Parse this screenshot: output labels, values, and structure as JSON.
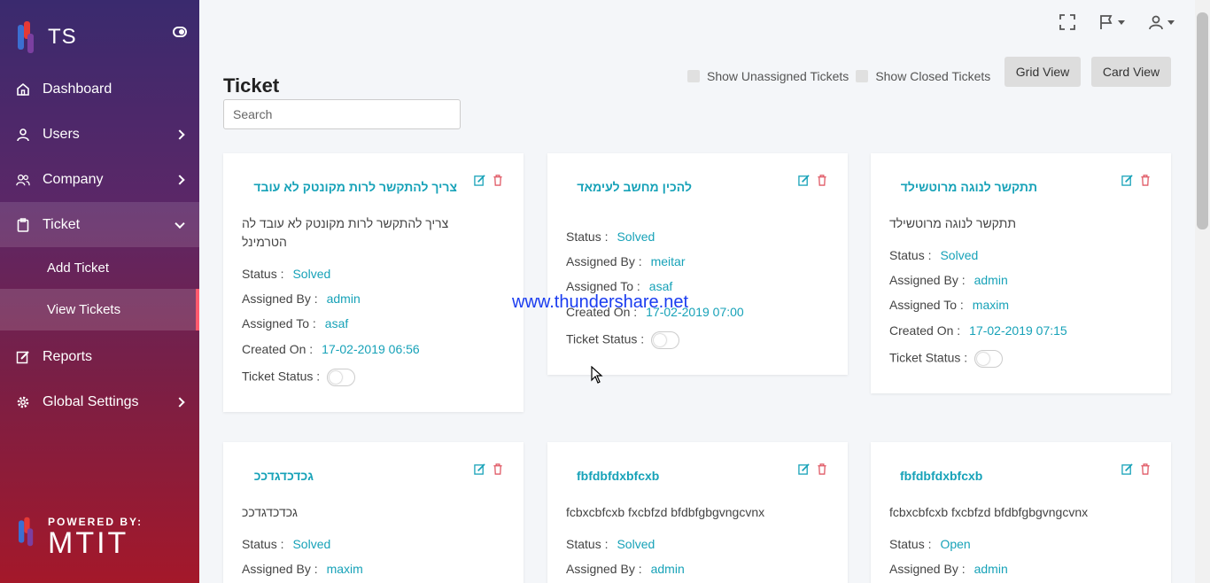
{
  "app": {
    "brand": "TS",
    "powered_by": "POWERED BY:",
    "powered_name": "MTIT"
  },
  "sidebar": {
    "items": [
      {
        "label": "Dashboard",
        "icon": "home-icon"
      },
      {
        "label": "Users",
        "icon": "user-icon"
      },
      {
        "label": "Company",
        "icon": "users-icon"
      },
      {
        "label": "Ticket",
        "icon": "clipboard-icon"
      },
      {
        "label": "Reports",
        "icon": "edit-icon"
      },
      {
        "label": "Global Settings",
        "icon": "gear-icon"
      }
    ],
    "ticket_sub": {
      "add": "Add Ticket",
      "view": "View Tickets"
    }
  },
  "header": {
    "title": "Ticket",
    "search_placeholder": "Search",
    "show_unassigned": "Show Unassigned Tickets",
    "show_closed": "Show Closed Tickets",
    "grid_view": "Grid View",
    "card_view": "Card View"
  },
  "labels": {
    "status": "Status :",
    "assigned_by": "Assigned By :",
    "assigned_to": "Assigned To :",
    "created_on": "Created On :",
    "ticket_status": "Ticket Status :"
  },
  "cards": [
    {
      "title": "צריך להתקשר לרות מקונטק לא עובד",
      "desc": "צריך להתקשר לרות מקונטק לא עובד לה הטרמינל",
      "status": "Solved",
      "assigned_by": "admin",
      "assigned_to": "asaf",
      "created_on": "17-02-2019 06:56"
    },
    {
      "title": "להכין מחשב לעימאד",
      "desc": "",
      "status": "Solved",
      "assigned_by": "meitar",
      "assigned_to": "asaf",
      "created_on": "17-02-2019 07:00"
    },
    {
      "title": "תתקשר לנוגה מרוטשילד",
      "desc": "תתקשר לנוגה מרוטשילד",
      "status": "Solved",
      "assigned_by": "admin",
      "assigned_to": "maxim",
      "created_on": "17-02-2019 07:15"
    },
    {
      "title": "גכדכדגדככ",
      "desc": "גכדכדגדככ",
      "status": "Solved",
      "assigned_by": "maxim"
    },
    {
      "title": "fbfdbfdxbfcxb",
      "desc": "fcbxcbfcxb fxcbfzd bfdbfgbgvngcvnx",
      "status": "Solved",
      "assigned_by": "admin"
    },
    {
      "title": "fbfdbfdxbfcxb",
      "desc": "fcbxcbfcxb fxcbfzd bfdbfgbgvngcvnx",
      "status": "Open",
      "assigned_by": "admin"
    }
  ],
  "watermark": "www.thundershare.net"
}
